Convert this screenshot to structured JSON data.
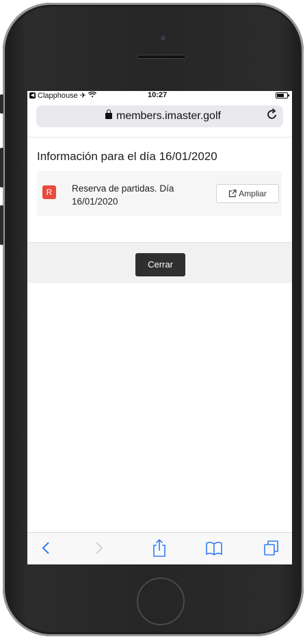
{
  "status_bar": {
    "carrier": "Clapphouse",
    "time": "10:27",
    "battery_level": 0.8
  },
  "browser": {
    "url": "members.imaster.golf"
  },
  "page": {
    "title": "Información para el día 16/01/2020",
    "item": {
      "badge": "R",
      "text": "Reserva de partidas. Día 16/01/2020",
      "action_label": "Ampliar"
    },
    "close_label": "Cerrar"
  },
  "toolbar": {
    "items": [
      "back-icon",
      "forward-icon",
      "share-icon",
      "bookmarks-icon",
      "tabs-icon"
    ]
  },
  "colors": {
    "badge": "#e94a3c",
    "close_button": "#2f2f2f",
    "toolbar_icons": "#2f7bf5"
  }
}
